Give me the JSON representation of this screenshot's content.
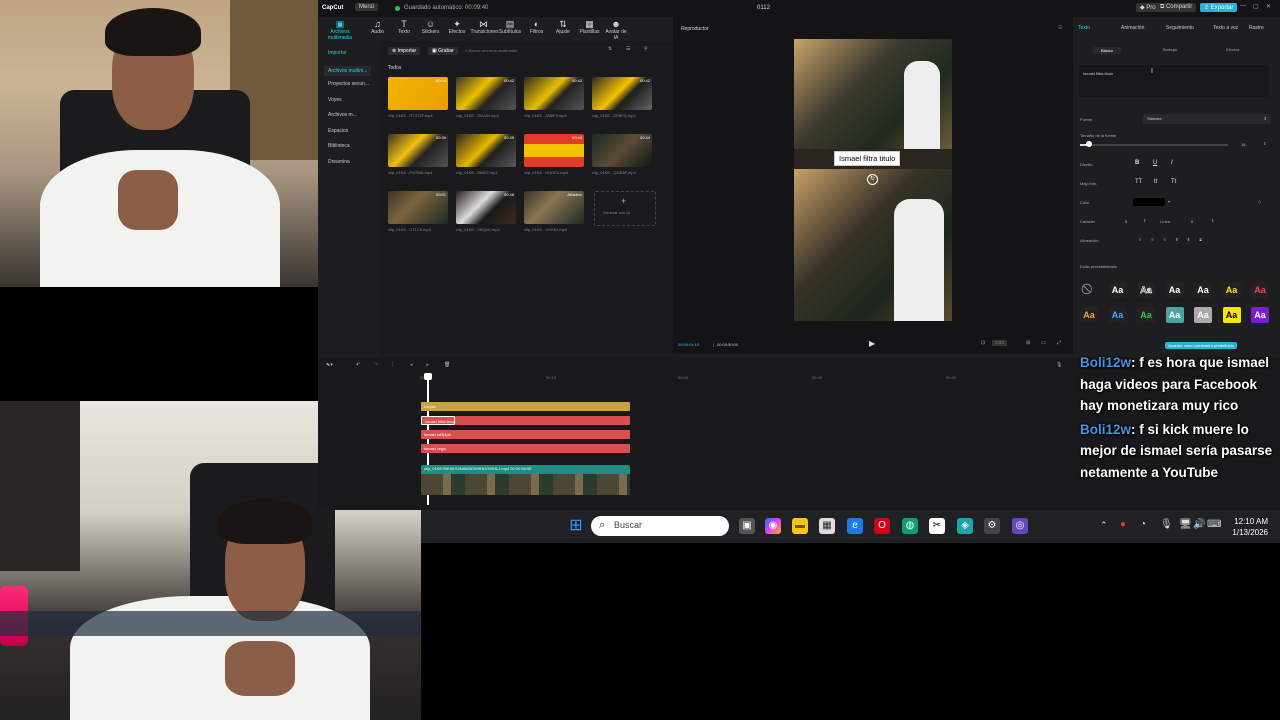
{
  "app": {
    "name": "CapCut",
    "menu_label": "Menú",
    "autosave": "Guardado automático: 00:09:40",
    "project_name": "0112",
    "pro_label": "Pro",
    "share_label": "Compartir",
    "export_label": "Exportar"
  },
  "toolbar": [
    {
      "label": "Archivos multimedia",
      "icon": "media-icon"
    },
    {
      "label": "Audio",
      "icon": "audio-icon"
    },
    {
      "label": "Texto",
      "icon": "text-icon"
    },
    {
      "label": "Stickers",
      "icon": "sticker-icon"
    },
    {
      "label": "Efectos",
      "icon": "effects-icon"
    },
    {
      "label": "Transiciones",
      "icon": "transitions-icon"
    },
    {
      "label": "Subtítulos",
      "icon": "subtitles-icon"
    },
    {
      "label": "Filtros",
      "icon": "filters-icon"
    },
    {
      "label": "Ajuste",
      "icon": "adjust-icon"
    },
    {
      "label": "Plantillas",
      "icon": "templates-icon"
    },
    {
      "label": "Avatar de IA",
      "icon": "avatar-icon"
    }
  ],
  "sidebar": {
    "items": [
      "Importar",
      "Archivos multim...",
      "Proyectos secun...",
      "Voyes",
      "Archivos m...",
      "Espacios",
      "Biblioteca",
      "Dreamina"
    ]
  },
  "media": {
    "import_label": "Importar",
    "save_label": "Grabar",
    "search_placeholder": "Buscar archivos multimedia",
    "filter_label": "Todos",
    "add_ai_label": "Generar con IA",
    "clips": [
      {
        "name": "clip_01KE...RT3TZF.mp4",
        "dur": "00:04"
      },
      {
        "name": "clip_01KE...3VUAV.mp4",
        "dur": "00:42"
      },
      {
        "name": "clip_01KE...3M8FV.mp4",
        "dur": "00:42"
      },
      {
        "name": "clip_01KE...DP8FQ.mp4",
        "dur": "00:42"
      },
      {
        "name": "clip_01KE...PNTMA.mp4",
        "dur": "00:39"
      },
      {
        "name": "clip_01KE...Sb80T.mp4",
        "dur": "00:39"
      },
      {
        "name": "clip_01KE...HDHD3.mp4",
        "dur": "00:44"
      },
      {
        "name": "clip_01KE...QGEAF.mp4",
        "dur": "00:44"
      },
      {
        "name": "clip_01KE...CT1C5.mp4",
        "dur": "00:51"
      },
      {
        "name": "clip_01KE...VBQNJ.mp4",
        "dur": "00:48"
      },
      {
        "name": "clip_01KE...VXHSJ.mp4",
        "dur": "Añadido"
      }
    ]
  },
  "player": {
    "title": "Reproductor",
    "caption": "Ismael filtra titulo",
    "time_current": "00:00:04:15",
    "time_total": "00:00:50:00"
  },
  "properties": {
    "tabs": [
      "Texto",
      "Animación",
      "Seguimiento",
      "Texto a voz",
      "Rastre"
    ],
    "subtabs": [
      "Básico",
      "Burbuja",
      "Efectos"
    ],
    "text_value": "Ismael filtra titulo",
    "font_label": "Fuente",
    "font_value": "Sistema",
    "size_label": "Tamaño de la fuente",
    "size_value": "15",
    "size_fraction": 0.06,
    "style_label": "Diseño",
    "case_label": "May./min.",
    "color_label": "Color",
    "color_value": "#000000",
    "char_label": "Carácter",
    "char_value": "0",
    "line_label": "Línea",
    "line_value": "0",
    "align_label": "Alineación",
    "preset_label": "Estilo preestablecido",
    "save_preset": "Guardar como parámetro predefinido",
    "preset_glyph": "Aa"
  },
  "timeline": {
    "ruler": [
      "00:00",
      "00:10",
      "00:20",
      "00:30",
      "00:40"
    ],
    "tracks": [
      {
        "label": "Limpio",
        "color": "#c9a43a"
      },
      {
        "label": "Ismael filtra titulo",
        "color": "#d94f4f"
      },
      {
        "label": "Ismael sd9j4pll",
        "color": "#d94f4f"
      },
      {
        "label": "Ismael vega",
        "color": "#d94f4f"
      }
    ],
    "video_clip": "clip_01KE7BK9KG2NAW3DW9HLVHXHLJ.mp4  00:00:50:00"
  },
  "taskbar": {
    "search_placeholder": "Buscar",
    "time": "12:10 AM",
    "date": "1/13/2026"
  },
  "chat": [
    {
      "user": "Boli12w",
      "text": ": f es hora que ismael haga videos para Facebook hay monetizara muy rico"
    },
    {
      "user": "Boli12w",
      "text": ": f si kick muere lo mejor de ismael sería pasarse netamente a YouTube"
    }
  ]
}
